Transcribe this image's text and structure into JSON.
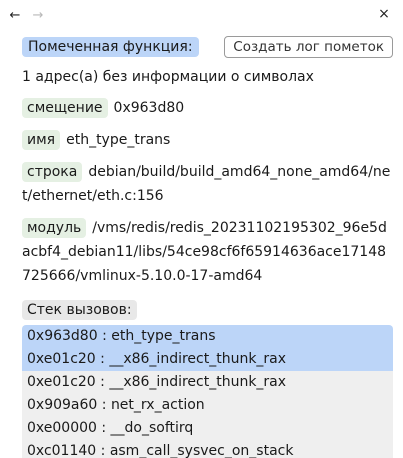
{
  "nav": {
    "back_glyph": "←",
    "forward_glyph": "→",
    "close_glyph": "×"
  },
  "header": {
    "title": "Помеченная функция:",
    "log_button": "Создать лог пометок"
  },
  "info_text": "1 адрес(а) без информации о символах",
  "fields": {
    "offset": {
      "label": "смещение",
      "value": "0x963d80"
    },
    "name": {
      "label": "имя",
      "value": "eth_type_trans"
    },
    "line": {
      "label": "строка",
      "value": "debian/build/build_amd64_none_amd64/net/ethernet/eth.c:156"
    },
    "module": {
      "label": "модуль",
      "value": "/vms/redis/redis_20231102195302_96e5dacbf4_debian11/libs/54ce98cf6f65914636ace17148725666/vmlinux-5.10.0-17-amd64"
    }
  },
  "stack": {
    "title": "Стек вызовов:",
    "frames": [
      {
        "addr": "0x963d80",
        "sep": " : ",
        "fn": "eth_type_trans"
      },
      {
        "addr": "0xe01c20",
        "sep": " : ",
        "fn": "__x86_indirect_thunk_rax"
      },
      {
        "addr": "0xe01c20",
        "sep": " : ",
        "fn": "__x86_indirect_thunk_rax"
      },
      {
        "addr": "0x909a60",
        "sep": " : ",
        "fn": "net_rx_action"
      },
      {
        "addr": "0xe00000",
        "sep": " : ",
        "fn": "__do_softirq"
      },
      {
        "addr": "0xc01140",
        "sep": " : ",
        "fn": "asm_call_sysvec_on_stack"
      }
    ]
  },
  "colors": {
    "highlight": "#bcd5f8",
    "field_label_bg": "#e5f0e3",
    "frame_bg": "#efefef"
  }
}
